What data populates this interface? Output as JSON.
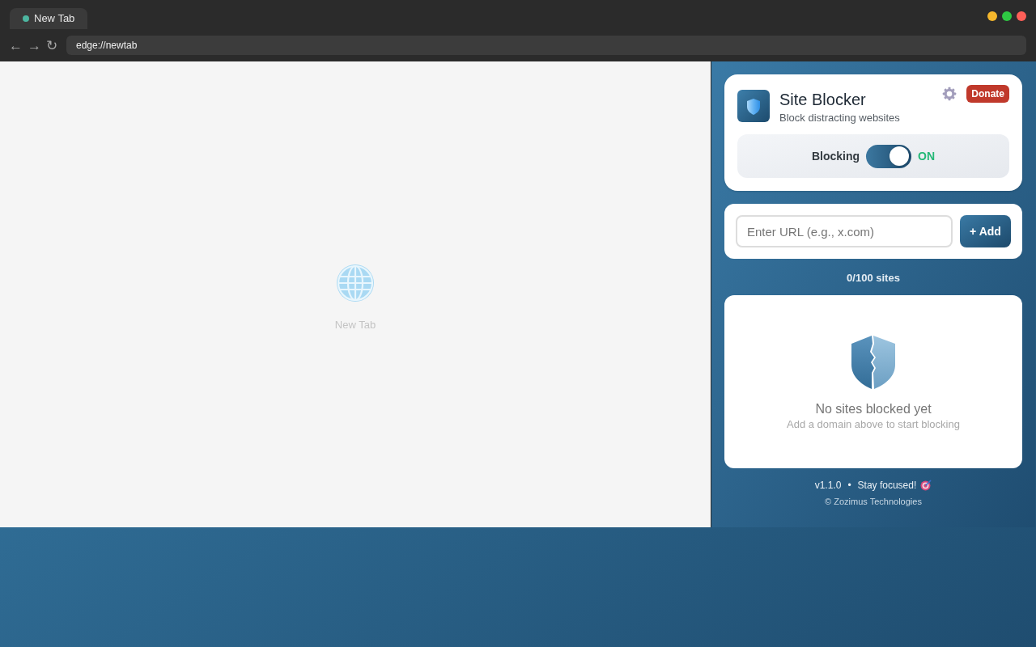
{
  "browser": {
    "tabs": [
      {
        "title": "New Tab",
        "selected": true
      }
    ],
    "window_controls": [
      {
        "color": "#f5b72c"
      },
      {
        "color": "#2ec843"
      },
      {
        "color": "#fe5f58"
      }
    ],
    "nav_buttons": [
      "←",
      "→",
      "↻"
    ],
    "address": "edge://newtab"
  },
  "new_tab_page": {
    "label": "New Tab"
  },
  "extension": {
    "title": "Site Blocker",
    "subtitle": "Block distracting websites",
    "donate": "Donate",
    "blocking": {
      "label": "Blocking",
      "on": true,
      "state_text": "ON"
    },
    "add_form": {
      "placeholder": "Enter URL (e.g., x.com)",
      "button": "+ Add"
    },
    "site_count": "0/100 sites",
    "empty_state": {
      "title": "No sites blocked yet",
      "hint": "Add a domain above to start blocking"
    },
    "footer": {
      "version": "v1.1.0",
      "separator": "•",
      "tagline": "Stay focused!",
      "copyright": "© Zozimus Technologies"
    }
  }
}
